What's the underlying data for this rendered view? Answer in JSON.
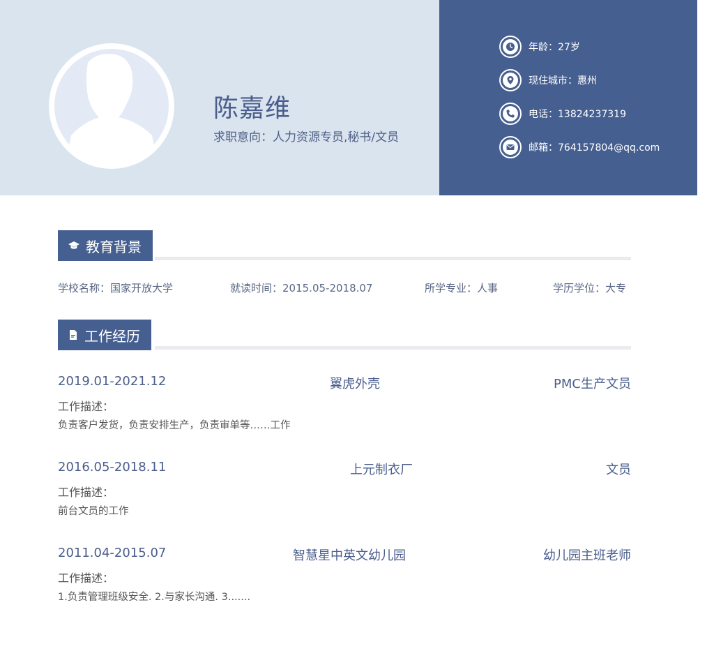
{
  "profile": {
    "name": "陈嘉维",
    "intent": "求职意向：人力资源专员,秘书/文员"
  },
  "contacts": [
    {
      "icon": "clock-icon",
      "text": "年龄：27岁"
    },
    {
      "icon": "location-pin-icon",
      "text": "现住城市：惠州"
    },
    {
      "icon": "phone-icon",
      "text": "电话：13824237319"
    },
    {
      "icon": "mail-icon",
      "text": "邮箱：764157804@qq.com"
    }
  ],
  "education": {
    "title": "教育背景",
    "school": "学校名称：国家开放大学",
    "period": "就读时间：2015.05-2018.07",
    "major": "所学专业：人事",
    "degree": "学历学位：大专"
  },
  "work": {
    "title": "工作经历",
    "jobs": [
      {
        "date": "2019.01-2021.12",
        "company": "翼虎外壳",
        "role": "PMC生产文员",
        "desc_label": "工作描述：",
        "desc": "负责客户发货，负责安排生产，负责审单等……工作"
      },
      {
        "date": "2016.05-2018.11",
        "company": "上元制衣厂",
        "role": "文员",
        "desc_label": "工作描述：",
        "desc": "前台文员的工作"
      },
      {
        "date": "2011.04-2015.07",
        "company": "智慧星中英文幼儿园",
        "role": "幼儿园主班老师",
        "desc_label": "工作描述：",
        "desc": "1.负责管理班级安全. 2.与家长沟通. 3......."
      }
    ]
  },
  "colors": {
    "header_light": "#dae4ef",
    "header_dark": "#455f90",
    "accent_text": "#4a5d8c"
  }
}
